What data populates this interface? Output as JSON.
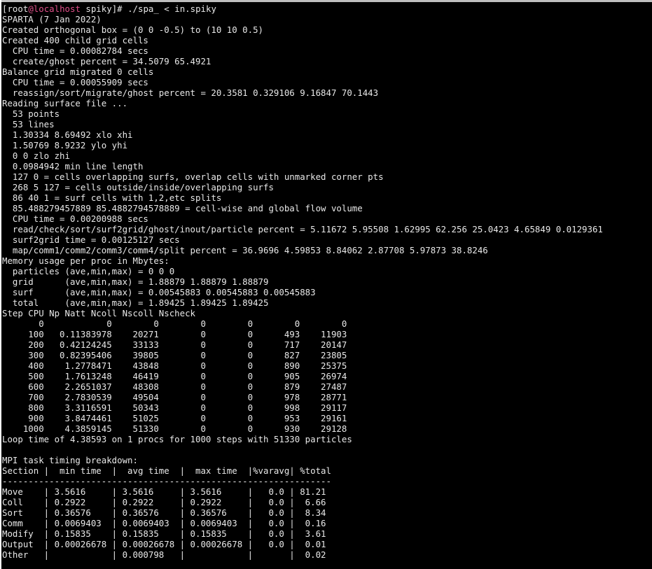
{
  "prompt": {
    "user": "root",
    "at": "@",
    "host": "localhost",
    "cwd": "spiky",
    "command": "./spa_ < in.spiky"
  },
  "lines": [
    "SPARTA (7 Jan 2022)",
    "Created orthogonal box = (0 0 -0.5) to (10 10 0.5)",
    "Created 400 child grid cells",
    "  CPU time = 0.00082784 secs",
    "  create/ghost percent = 34.5079 65.4921",
    "Balance grid migrated 0 cells",
    "  CPU time = 0.00055909 secs",
    "  reassign/sort/migrate/ghost percent = 20.3581 0.329106 9.16847 70.1443",
    "Reading surface file ...",
    "  53 points",
    "  53 lines",
    "  1.30334 8.69492 xlo xhi",
    "  1.50769 8.9232 ylo yhi",
    "  0 0 zlo zhi",
    "  0.0984942 min line length",
    "  127 0 = cells overlapping surfs, overlap cells with unmarked corner pts",
    "  268 5 127 = cells outside/inside/overlapping surfs",
    "  86 40 1 = surf cells with 1,2,etc splits",
    "  85.488279457889 85.4882794578889 = cell-wise and global flow volume",
    "  CPU time = 0.00200988 secs",
    "  read/check/sort/surf2grid/ghost/inout/particle percent = 5.11672 5.95508 1.62995 62.256 25.0423 4.65849 0.0129361",
    "  surf2grid time = 0.00125127 secs",
    "  map/comm1/comm2/comm3/comm4/split percent = 36.9696 4.59853 8.84062 2.87708 5.97873 38.8246",
    "Memory usage per proc in Mbytes:",
    "  particles (ave,min,max) = 0 0 0",
    "  grid      (ave,min,max) = 1.88879 1.88879 1.88879",
    "  surf      (ave,min,max) = 0.00545883 0.00545883 0.00545883",
    "  total     (ave,min,max) = 1.89425 1.89425 1.89425",
    "Step CPU Np Natt Ncoll Nscoll Nscheck",
    "       0            0        0        0        0        0        0",
    "     100   0.11383978    20271        0        0      493    11903",
    "     200   0.42124245    33133        0        0      717    20147",
    "     300   0.82395406    39805        0        0      827    23805",
    "     400    1.2778471    43848        0        0      890    25375",
    "     500    1.7613248    46419        0        0      905    26974",
    "     600    2.2651037    48308        0        0      879    27487",
    "     700    2.7830539    49504        0        0      978    28771",
    "     800    3.3116591    50343        0        0      998    29117",
    "     900    3.8474461    51025        0        0      953    29161",
    "    1000    4.3859145    51330        0        0      930    29128",
    "Loop time of 4.38593 on 1 procs for 1000 steps with 51330 particles",
    "",
    "MPI task timing breakdown:",
    "Section |  min time  |  avg time  |  max time  |%varavg| %total",
    "---------------------------------------------------------------",
    "Move    | 3.5616     | 3.5616     | 3.5616     |   0.0 | 81.21",
    "Coll    | 0.2922     | 0.2922     | 0.2922     |   0.0 |  6.66",
    "Sort    | 0.36576    | 0.36576    | 0.36576    |   0.0 |  8.34",
    "Comm    | 0.0069403  | 0.0069403  | 0.0069403  |   0.0 |  0.16",
    "Modify  | 0.15835    | 0.15835    | 0.15835    |   0.0 |  3.61",
    "Output  | 0.00026678 | 0.00026678 | 0.00026678 |   0.0 |  0.01",
    "Other   |            | 0.000798   |            |       |  0.02"
  ]
}
